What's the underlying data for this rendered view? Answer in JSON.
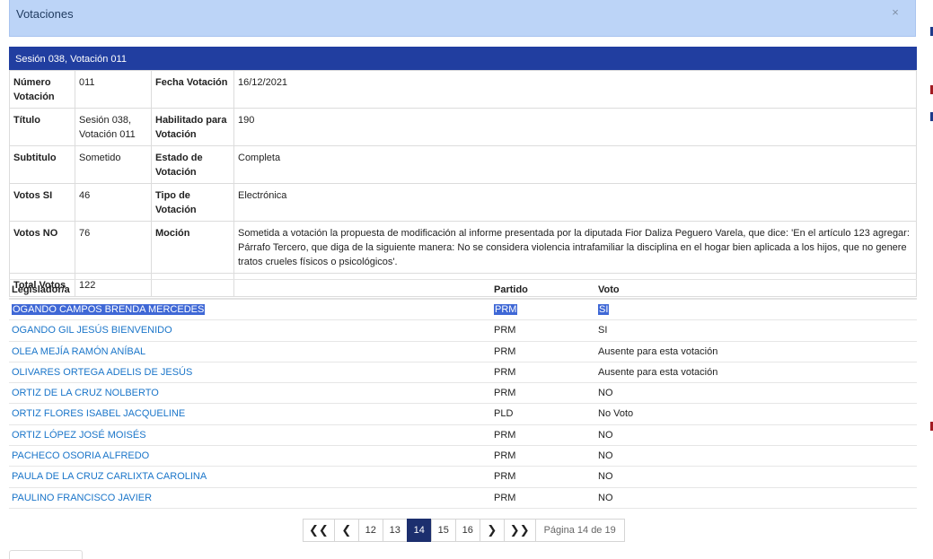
{
  "modal": {
    "title": "Votaciones",
    "close_symbol": "×"
  },
  "session_title": "Sesión 038, Votación 011",
  "info": {
    "numero_label": "Número Votación",
    "numero_value": "011",
    "fecha_label": "Fecha Votación",
    "fecha_value": "16/12/2021",
    "titulo_label": "Título",
    "titulo_value": "Sesión 038, Votación 011",
    "habilitado_label": "Habilitado para Votación",
    "habilitado_value": "190",
    "subtitulo_label": "Subtitulo",
    "subtitulo_value": "Sometido",
    "estado_label": "Estado de Votación",
    "estado_value": "Completa",
    "votos_si_label": "Votos SI",
    "votos_si_value": "46",
    "tipo_label": "Tipo de Votación",
    "tipo_value": "Electrónica",
    "votos_no_label": "Votos NO",
    "votos_no_value": "76",
    "mocion_label": "Moción",
    "mocion_value": "Sometida a votación la propuesta de modificación al informe presentada por la diputada Fior Daliza Peguero Varela, que dice: 'En el artículo 123 agregar: Párrafo Tercero, que diga de la siguiente manera: No se considera violencia intrafamiliar la disciplina en el hogar bien aplicada a los hijos, que no genere tratos crueles físicos o psicológicos'.",
    "total_label": "Total Votos",
    "total_value": "122"
  },
  "list": {
    "headers": [
      "Legislador/a",
      "Partido",
      "Voto"
    ],
    "rows": [
      {
        "name": "OGANDO CAMPOS BRENDA MERCEDES",
        "party": "PRM",
        "vote": "SI"
      },
      {
        "name": "OGANDO GIL JESÚS BIENVENIDO",
        "party": "PRM",
        "vote": "SI"
      },
      {
        "name": "OLEA MEJÍA RAMÓN ANÍBAL",
        "party": "PRM",
        "vote": "Ausente para esta votación"
      },
      {
        "name": "OLIVARES ORTEGA ADELIS DE JESÚS",
        "party": "PRM",
        "vote": "Ausente para esta votación"
      },
      {
        "name": "ORTIZ DE LA CRUZ NOLBERTO",
        "party": "PRM",
        "vote": "NO"
      },
      {
        "name": "ORTIZ FLORES ISABEL JACQUELINE",
        "party": "PLD",
        "vote": "No Voto"
      },
      {
        "name": "ORTIZ LÓPEZ JOSÉ MOISÉS",
        "party": "PRM",
        "vote": "NO"
      },
      {
        "name": "PACHECO OSORIA ALFREDO",
        "party": "PRM",
        "vote": "NO"
      },
      {
        "name": "PAULA DE LA CRUZ CARLIXTA CAROLINA",
        "party": "PRM",
        "vote": "NO"
      },
      {
        "name": "PAULINO FRANCISCO JAVIER",
        "party": "PRM",
        "vote": "NO"
      }
    ]
  },
  "pager": {
    "first": "❮❮",
    "prev": "❮",
    "next": "❯",
    "last": "❯❯",
    "pages": [
      "12",
      "13",
      "14",
      "15",
      "16"
    ],
    "current": "14",
    "info": "Página 14 de 19"
  },
  "colors": {
    "header_bg": "#bcd4f7",
    "session_bar": "#213ea0",
    "link": "#1a75c9",
    "active_page": "#1c2f6e",
    "selection": "#3f68d6"
  }
}
